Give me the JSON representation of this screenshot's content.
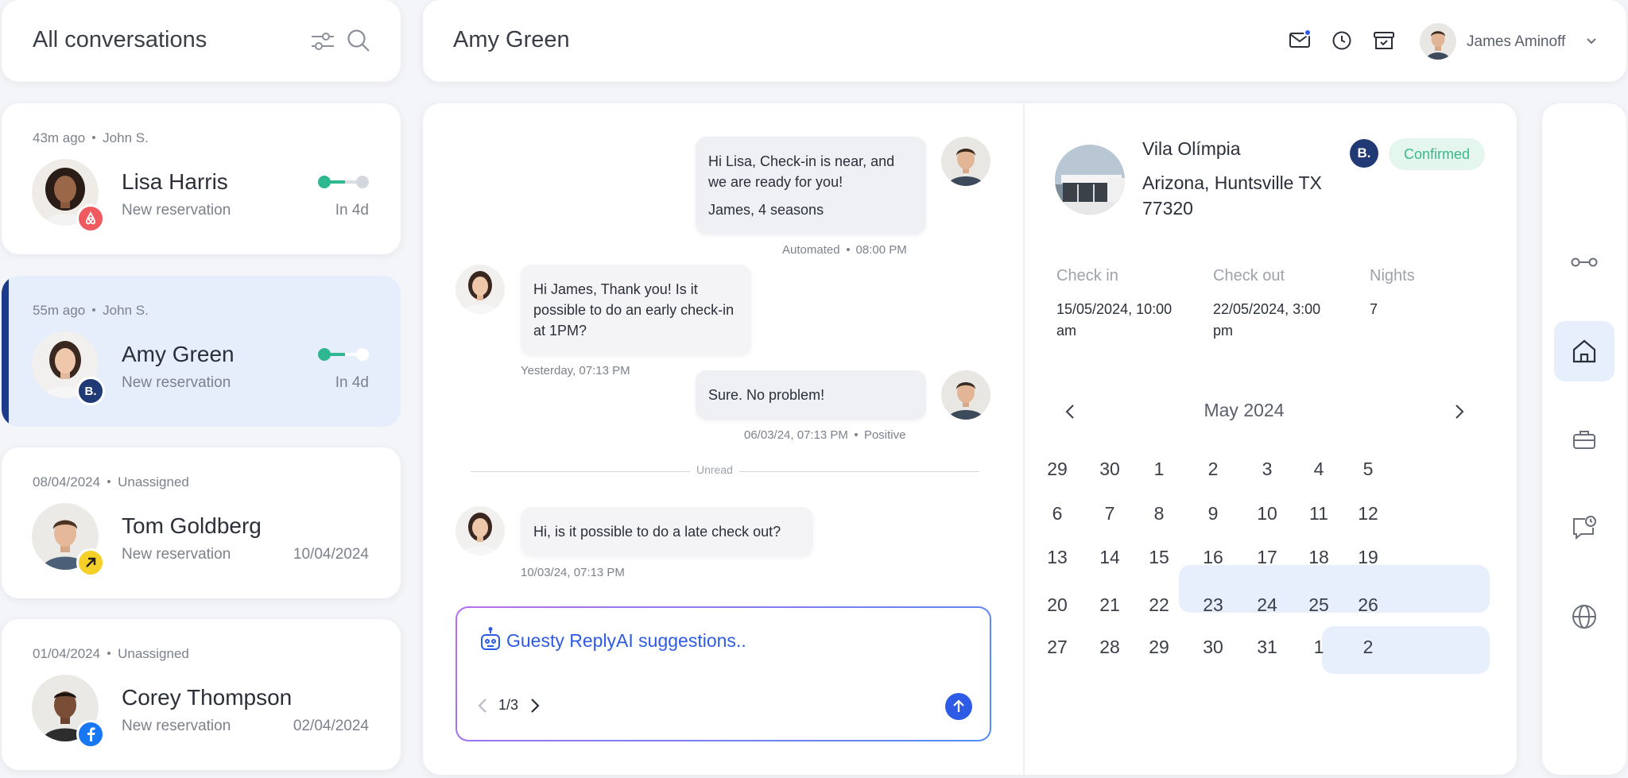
{
  "sidebar_header": {
    "title": "All conversations"
  },
  "header": {
    "title": "Amy Green",
    "user_name": "James Aminoff"
  },
  "conversations": [
    {
      "time": "43m ago",
      "agent": "John S.",
      "name": "Lisa Harris",
      "subtitle": "New reservation",
      "when": "In 4d",
      "channel": "airbnb-icon"
    },
    {
      "time": "55m ago",
      "agent": "John S.",
      "name": "Amy Green",
      "subtitle": "New reservation",
      "when": "In 4d",
      "channel": "booking-icon",
      "channel_letter": "B."
    },
    {
      "time": "08/04/2024",
      "agent": "Unassigned",
      "name": "Tom Goldberg",
      "subtitle": "New reservation",
      "when": "10/04/2024",
      "channel": "arrow-icon"
    },
    {
      "time": "01/04/2024",
      "agent": "Unassigned",
      "name": "Corey Thompson",
      "subtitle": "New reservation",
      "when": "02/04/2024",
      "channel": "facebook-icon"
    }
  ],
  "messages": [
    {
      "from": "host",
      "lines": [
        "Hi Lisa, Check-in is near, and we are ready for you!",
        "James, 4 seasons"
      ],
      "source": "Automated",
      "time": "08:00 PM"
    },
    {
      "from": "guest",
      "text": "Hi James, Thank you! Is it possible to do an early check-in at 1PM?",
      "time": "Yesterday, 07:13 PM"
    },
    {
      "from": "host",
      "text": "Sure. No problem!",
      "time": "06/03/24, 07:13 PM",
      "sentiment": "Positive"
    },
    {
      "from": "guest",
      "text": "Hi, is it possible to do a late check out?",
      "time": "10/03/24, 07:13 PM"
    }
  ],
  "unread_label": "Unread",
  "composer": {
    "suggestion": "Guesty ReplyAI suggestions..",
    "pager": "1/3"
  },
  "reservation": {
    "property_name": "Vila Olímpia",
    "address": "Arizona, Huntsville TX 77320",
    "channel_letter": "B.",
    "status": "Confirmed",
    "checkin_label": "Check in",
    "checkin_value": "15/05/2024, 10:00 am",
    "checkout_label": "Check out",
    "checkout_value": "22/05/2024, 3:00 pm",
    "nights_label": "Nights",
    "nights_value": "7"
  },
  "calendar": {
    "month": "May 2024",
    "weeks": [
      [
        "29",
        "30",
        "1",
        "2",
        "3",
        "4",
        "5"
      ],
      [
        "6",
        "7",
        "8",
        "9",
        "10",
        "11",
        "12"
      ],
      [
        "13",
        "14",
        "15",
        "16",
        "17",
        "18",
        "19"
      ],
      [
        "20",
        "21",
        "22",
        "23",
        "24",
        "25",
        "26"
      ],
      [
        "27",
        "28",
        "29",
        "30",
        "31",
        "1",
        "2"
      ]
    ]
  },
  "rail_icons": [
    "key-icon",
    "home-icon",
    "briefcase-icon",
    "chat-clock-icon",
    "globe-icon"
  ],
  "colors": {
    "accent": "#2e5be6",
    "active_bg": "#e6eefc",
    "active_bar": "#1e3a8a",
    "confirmed": "#3bb88a",
    "booking": "#1f3a75"
  }
}
